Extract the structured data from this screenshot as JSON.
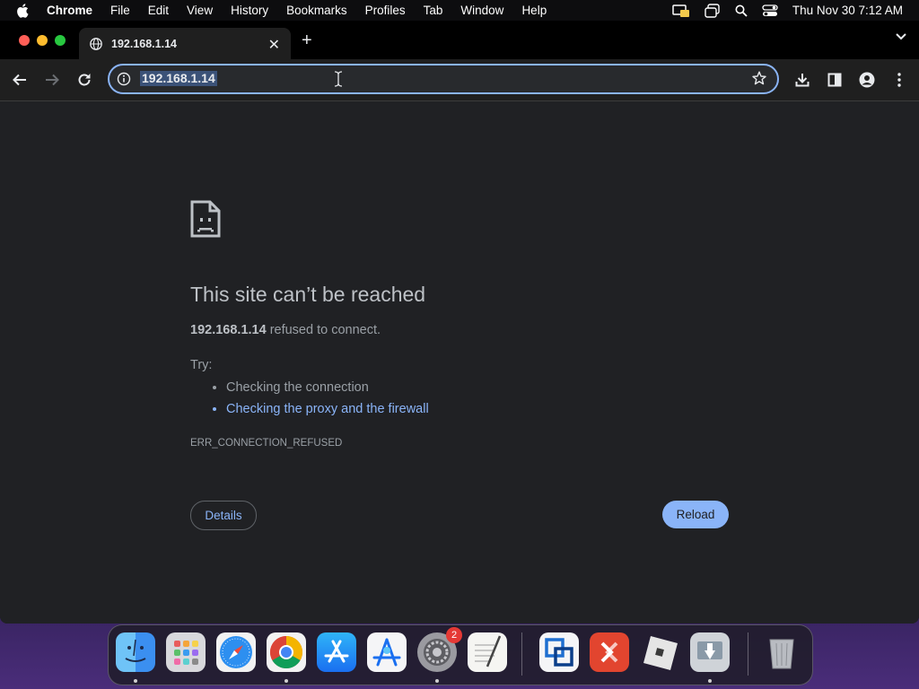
{
  "menubar": {
    "items": [
      "Chrome",
      "File",
      "Edit",
      "View",
      "History",
      "Bookmarks",
      "Profiles",
      "Tab",
      "Window",
      "Help"
    ],
    "clock": "Thu Nov 30  7:12 AM"
  },
  "tab": {
    "title": "192.168.1.14",
    "icon": "globe-icon"
  },
  "omnibox": {
    "url": "192.168.1.14"
  },
  "error": {
    "title": "This site can’t be reached",
    "host": "192.168.1.14",
    "desc_suffix": " refused to connect.",
    "try_label": "Try:",
    "suggestions": [
      "Checking the connection",
      "Checking the proxy and the firewall"
    ],
    "code": "ERR_CONNECTION_REFUSED",
    "details_label": "Details",
    "reload_label": "Reload"
  },
  "dock": {
    "apps": [
      "finder",
      "launchpad",
      "safari",
      "chrome",
      "app-store",
      "xcode-instruments",
      "system-settings",
      "textedit",
      "vmware-fusion",
      "remote-desktop",
      "roblox",
      "migration-assistant",
      "trash"
    ],
    "settings_badge": "2"
  },
  "colors": {
    "accent": "#8ab4f8",
    "page_bg": "#202124",
    "text_secondary": "#9aa0a6"
  }
}
